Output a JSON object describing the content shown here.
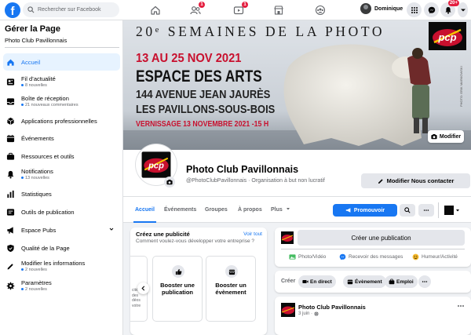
{
  "topbar": {
    "search_placeholder": "Rechercher sur Facebook",
    "home_badge": "",
    "friends_badge": "1",
    "video_badge": "1",
    "profile_name": "Dominique",
    "notifications_badge": "20+"
  },
  "sidebar": {
    "title": "Gérer la Page",
    "page_name": "Photo Club Pavillonnais",
    "items": [
      {
        "label": "Accueil",
        "note": ""
      },
      {
        "label": "Fil d’actualité",
        "note": "8 nouvelles"
      },
      {
        "label": "Boîte de réception",
        "note": "21 nouveaux commentaires"
      },
      {
        "label": "Applications professionnelles",
        "note": ""
      },
      {
        "label": "Événements",
        "note": ""
      },
      {
        "label": "Ressources et outils",
        "note": ""
      },
      {
        "label": "Notifications",
        "note": "13 nouvelles"
      },
      {
        "label": "Statistiques",
        "note": ""
      },
      {
        "label": "Outils de publication",
        "note": ""
      },
      {
        "label": "Espace Pubs",
        "note": ""
      },
      {
        "label": "Qualité de la Page",
        "note": ""
      },
      {
        "label": "Modifier les informations",
        "note": "2 nouvelles"
      },
      {
        "label": "Paramètres",
        "note": "2 nouvelles"
      }
    ]
  },
  "cover": {
    "headline": "20ᵉ SEMAINES DE LA PHOTO",
    "dates": "13 AU 25 NOV 2021",
    "venue": "ESPACE DES ARTS",
    "address_line1": "144 AVENUE JEAN JAURÈS",
    "address_line2": "LES PAVILLONS-SOUS-BOIS",
    "vernissage": "VERNISSAGE 13 NOVEMBRE 2021 -15 H",
    "credit": "PHOTO: ERIK MARKOWSKI",
    "edit_label": "Modifier"
  },
  "page": {
    "name": "Photo Club Pavillonnais",
    "handle": "@PhotoClubPavillonnais · Organisation à but non lucratif",
    "contact_button": "Modifier Nous contacter",
    "logo_text": "pcp"
  },
  "tabs": {
    "items": [
      "Accueil",
      "Événements",
      "Groupes",
      "À propos",
      "Plus"
    ],
    "promote_label": "Promouvoir"
  },
  "ad_card": {
    "title": "Créez une publicité",
    "see_all": "Voir tout",
    "subtitle": "Comment voulez-vous développer votre entreprise ?",
    "peek_text": "cité\ndes\ndéos\nvotre",
    "options": [
      {
        "label": "Booster une publication",
        "icon": "thumbs-up-icon"
      },
      {
        "label": "Booster un évènement",
        "icon": "calendar-icon"
      }
    ]
  },
  "post_card": {
    "create_label": "Créer une publication",
    "actions": [
      {
        "label": "Photo/Vidéo",
        "icon": "photo-icon",
        "color": "#45bd62"
      },
      {
        "label": "Recevoir des messages",
        "icon": "messenger-icon",
        "color": "#1877f2"
      },
      {
        "label": "Humeur/Activité",
        "icon": "smiley-icon",
        "color": "#f7b928"
      }
    ]
  },
  "create_bar": {
    "label": "Créer",
    "chips": [
      "En direct",
      "Évènement",
      "Emploi"
    ]
  },
  "feed": {
    "author": "Photo Club Pavillonnais",
    "date": "3 juin ·"
  },
  "colors": {
    "accent": "#1877f2",
    "badge": "#e41e3f",
    "logo_red": "#c8102e"
  }
}
